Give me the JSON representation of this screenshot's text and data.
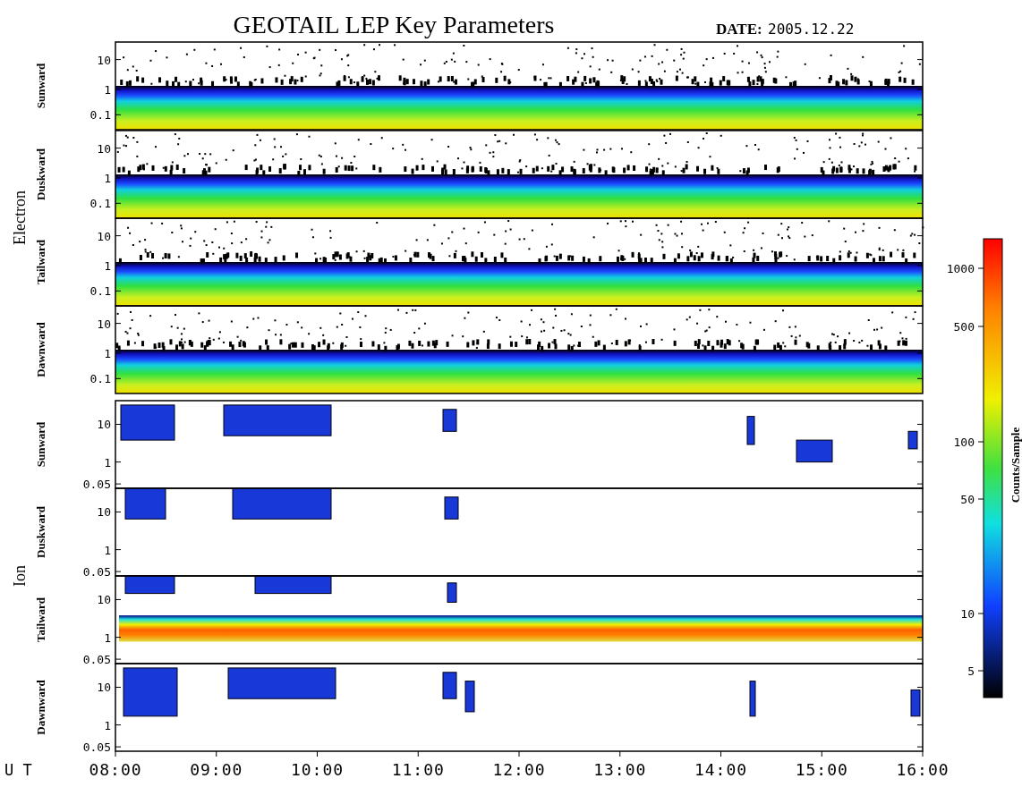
{
  "title": "GEOTAIL LEP Key Parameters",
  "date_label": "DATE:",
  "date": "2005.12.22",
  "groups": [
    {
      "label": "Electron",
      "kind": "electron",
      "panels": [
        {
          "label": "Sunward",
          "yticks": [
            "10",
            "1",
            "0.1"
          ]
        },
        {
          "label": "Duskward",
          "yticks": [
            "10",
            "1",
            "0.1"
          ]
        },
        {
          "label": "Tailward",
          "yticks": [
            "10",
            "1",
            "0.1"
          ]
        },
        {
          "label": "Dawnward",
          "yticks": [
            "10",
            "1",
            "0.1"
          ]
        }
      ]
    },
    {
      "label": "Ion",
      "kind": "ion",
      "panels": [
        {
          "label": "Sunward",
          "yticks": [
            "10",
            "1",
            "0.05"
          ]
        },
        {
          "label": "Duskward",
          "yticks": [
            "10",
            "1",
            "0.05"
          ]
        },
        {
          "label": "Tailward",
          "yticks": [
            "10",
            "1",
            "0.05"
          ]
        },
        {
          "label": "Dawnward",
          "yticks": [
            "10",
            "1",
            "0.05"
          ]
        }
      ]
    }
  ],
  "x_axis": {
    "label": "U T",
    "ticks": [
      "08:00",
      "09:00",
      "10:00",
      "11:00",
      "12:00",
      "13:00",
      "14:00",
      "15:00",
      "16:00"
    ]
  },
  "colorbar": {
    "label": "Counts/Sample",
    "ticks": [
      "1000",
      "500",
      "100",
      "50",
      "10",
      "5"
    ]
  }
}
